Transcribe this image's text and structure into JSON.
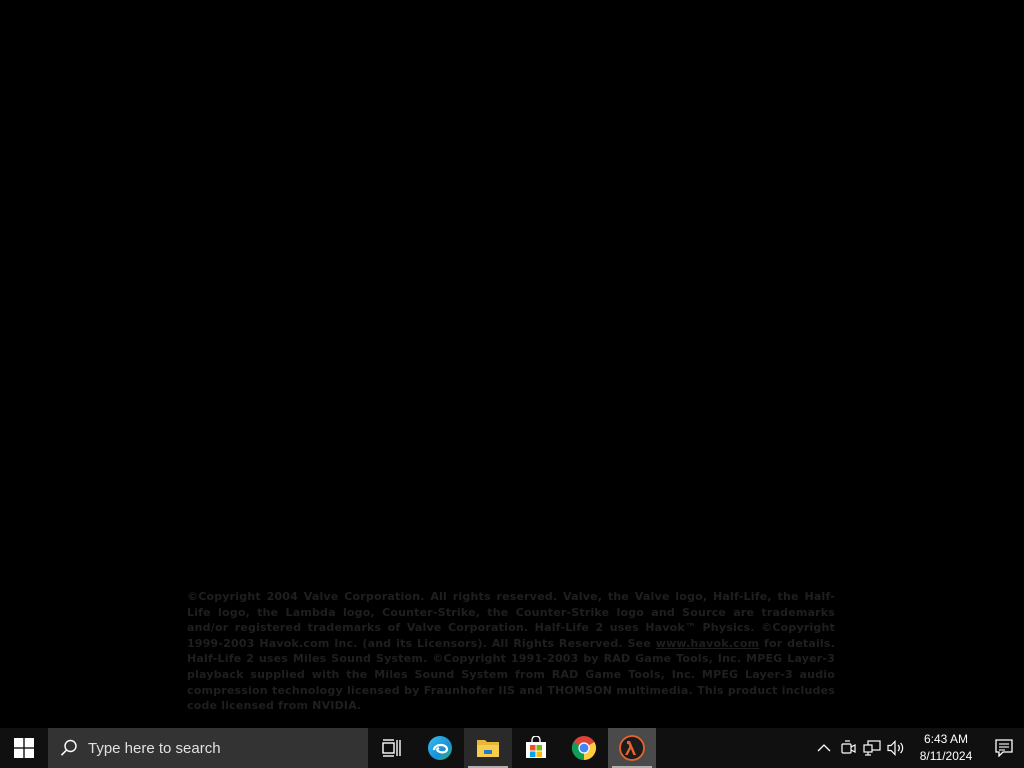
{
  "game": {
    "legal_before_link": "©Copyright 2004 Valve Corporation.  All rights reserved.  Valve, the Valve logo, Half-Life, the Half-Life logo, the Lambda logo, Counter-Strike, the Counter-Strike logo and Source are trademarks and/or registered trademarks of Valve Corporation.  Half-Life 2 uses Havok™ Physics. ©Copyright 1999-2003 Havok.com Inc. (and its Licensors).  All Rights Reserved.  See ",
    "legal_link": "www.havok.com",
    "legal_after_link": " for details.  Half-Life 2 uses Miles Sound System. ©Copyright 1991-2003 by RAD Game Tools, Inc. MPEG Layer-3 playback supplied with the Miles Sound System from RAD Game Tools, Inc. MPEG Layer-3 audio compression technology licensed by Fraunhofer IIS and THOMSON multimedia. This product includes code licensed from NVIDIA.",
    "text_color": "#1f1f1f"
  },
  "taskbar": {
    "start_icon": "windows-logo-icon",
    "search": {
      "placeholder": "Type here to search",
      "icon": "search-icon"
    },
    "apps": [
      {
        "name": "task-view",
        "icon": "task-view-icon"
      },
      {
        "name": "edge",
        "icon": "edge-icon"
      },
      {
        "name": "file-explorer",
        "icon": "folder-icon"
      },
      {
        "name": "microsoft-store",
        "icon": "store-icon"
      },
      {
        "name": "chrome",
        "icon": "chrome-icon"
      },
      {
        "name": "half-life-2",
        "icon": "lambda-icon"
      }
    ],
    "tray": {
      "icons": [
        "chevron-up-icon",
        "meet-now-icon",
        "network-icon",
        "volume-icon"
      ]
    },
    "clock": {
      "time": "6:43 AM",
      "date": "8/11/2024"
    },
    "notification_icon": "notification-icon"
  },
  "colors": {
    "background": "#000000",
    "taskbar": "#101010",
    "search_box": "#333333",
    "accent_lambda": "#e8642c"
  }
}
